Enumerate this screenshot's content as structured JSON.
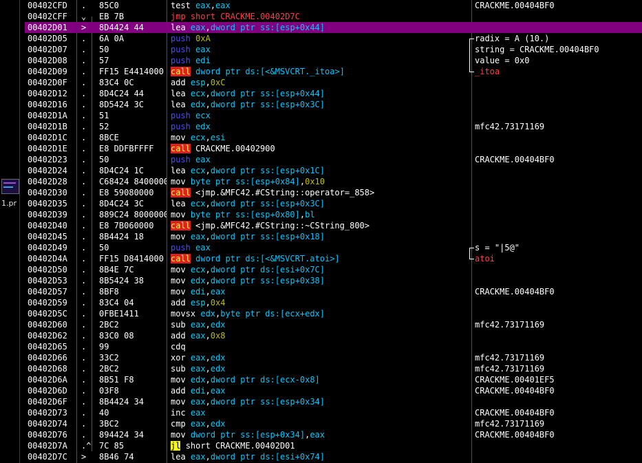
{
  "left_panel": {
    "thumbnail_label": "1.pr"
  },
  "rows": [
    {
      "addr": "00402CFD",
      "mark": ".",
      "hex": "85C0",
      "m": "test",
      "ops": [
        {
          "t": "eax",
          "k": "reg"
        },
        {
          "t": ",",
          "k": "sym"
        },
        {
          "t": "eax",
          "k": "reg"
        }
      ],
      "comment": "CRACKME.00404BF0"
    },
    {
      "addr": "00402CFF",
      "mark": "⌄",
      "hex": "EB 7B",
      "m": "jmp",
      "ops": [
        {
          "t": "short CRACKME.00402D7C",
          "k": "jmp"
        }
      ],
      "comment": ""
    },
    {
      "addr": "00402D01",
      "mark": ">",
      "hex": "8D4424 44",
      "m": "lea",
      "ops": [
        {
          "t": "eax",
          "k": "reg"
        },
        {
          "t": ",",
          "k": "sym"
        },
        {
          "t": "dword ptr ss:[esp+0x44]",
          "k": "mem"
        }
      ],
      "comment": "",
      "selected": true
    },
    {
      "addr": "00402D05",
      "mark": ".",
      "hex": "6A 0A",
      "m": "push",
      "ops": [
        {
          "t": "0xA",
          "k": "imm"
        }
      ],
      "comment": "radix = A (10.)",
      "bracket": "top"
    },
    {
      "addr": "00402D07",
      "mark": ".",
      "hex": "50",
      "m": "push",
      "ops": [
        {
          "t": "eax",
          "k": "reg"
        }
      ],
      "comment": "string = CRACKME.00404BF0",
      "bracket": "mid"
    },
    {
      "addr": "00402D08",
      "mark": ".",
      "hex": "57",
      "m": "push",
      "ops": [
        {
          "t": "edi",
          "k": "reg"
        }
      ],
      "comment": "value = 0x0",
      "bracket": "mid"
    },
    {
      "addr": "00402D09",
      "mark": ".",
      "hex": "FF15 E4414000",
      "m": "call",
      "ops": [
        {
          "t": "dword ptr ds:[<&MSVCRT._itoa>]",
          "k": "mem"
        }
      ],
      "comment": "_itoa",
      "bracket": "bot",
      "ccall": true
    },
    {
      "addr": "00402D0F",
      "mark": ".",
      "hex": "83C4 0C",
      "m": "add",
      "ops": [
        {
          "t": "esp",
          "k": "reg"
        },
        {
          "t": ",",
          "k": "sym"
        },
        {
          "t": "0xC",
          "k": "imm"
        }
      ],
      "comment": ""
    },
    {
      "addr": "00402D12",
      "mark": ".",
      "hex": "8D4C24 44",
      "m": "lea",
      "ops": [
        {
          "t": "ecx",
          "k": "reg"
        },
        {
          "t": ",",
          "k": "sym"
        },
        {
          "t": "dword ptr ss:[esp+0x44]",
          "k": "mem"
        }
      ],
      "comment": ""
    },
    {
      "addr": "00402D16",
      "mark": ".",
      "hex": "8D5424 3C",
      "m": "lea",
      "ops": [
        {
          "t": "edx",
          "k": "reg"
        },
        {
          "t": ",",
          "k": "sym"
        },
        {
          "t": "dword ptr ss:[esp+0x3C]",
          "k": "mem"
        }
      ],
      "comment": ""
    },
    {
      "addr": "00402D1A",
      "mark": ".",
      "hex": "51",
      "m": "push",
      "ops": [
        {
          "t": "ecx",
          "k": "reg"
        }
      ],
      "comment": ""
    },
    {
      "addr": "00402D1B",
      "mark": ".",
      "hex": "52",
      "m": "push",
      "ops": [
        {
          "t": "edx",
          "k": "reg"
        }
      ],
      "comment": "mfc42.73171169"
    },
    {
      "addr": "00402D1C",
      "mark": ".",
      "hex": "8BCE",
      "m": "mov",
      "ops": [
        {
          "t": "ecx",
          "k": "reg"
        },
        {
          "t": ",",
          "k": "sym"
        },
        {
          "t": "esi",
          "k": "reg"
        }
      ],
      "comment": ""
    },
    {
      "addr": "00402D1E",
      "mark": ".",
      "hex": "E8 DDFBFFFF",
      "m": "call",
      "ops": [
        {
          "t": "CRACKME.00402900",
          "k": "lbl"
        }
      ],
      "comment": ""
    },
    {
      "addr": "00402D23",
      "mark": ".",
      "hex": "50",
      "m": "push",
      "ops": [
        {
          "t": "eax",
          "k": "reg"
        }
      ],
      "comment": "CRACKME.00404BF0"
    },
    {
      "addr": "00402D24",
      "mark": ".",
      "hex": "8D4C24 1C",
      "m": "lea",
      "ops": [
        {
          "t": "ecx",
          "k": "reg"
        },
        {
          "t": ",",
          "k": "sym"
        },
        {
          "t": "dword ptr ss:[esp+0x1C]",
          "k": "mem"
        }
      ],
      "comment": ""
    },
    {
      "addr": "00402D28",
      "mark": ".",
      "hex": "C68424 84000000",
      "m": "mov",
      "ops": [
        {
          "t": "byte ptr ss:[esp+0x84]",
          "k": "mem"
        },
        {
          "t": ",",
          "k": "sym"
        },
        {
          "t": "0x10",
          "k": "imm"
        }
      ],
      "comment": ""
    },
    {
      "addr": "00402D30",
      "mark": ".",
      "hex": "E8 59080000",
      "m": "call",
      "ops": [
        {
          "t": "<jmp.&MFC42.#CString::operator=_858>",
          "k": "lbl"
        }
      ],
      "comment": ""
    },
    {
      "addr": "00402D35",
      "mark": ".",
      "hex": "8D4C24 3C",
      "m": "lea",
      "ops": [
        {
          "t": "ecx",
          "k": "reg"
        },
        {
          "t": ",",
          "k": "sym"
        },
        {
          "t": "dword ptr ss:[esp+0x3C]",
          "k": "mem"
        }
      ],
      "comment": ""
    },
    {
      "addr": "00402D39",
      "mark": ".",
      "hex": "889C24 80000000",
      "m": "mov",
      "ops": [
        {
          "t": "byte ptr ss:[esp+0x80]",
          "k": "mem"
        },
        {
          "t": ",",
          "k": "sym"
        },
        {
          "t": "bl",
          "k": "reg"
        }
      ],
      "comment": ""
    },
    {
      "addr": "00402D40",
      "mark": ".",
      "hex": "E8 7B060000",
      "m": "call",
      "ops": [
        {
          "t": "<jmp.&MFC42.#CString::~CString_800>",
          "k": "lbl"
        }
      ],
      "comment": ""
    },
    {
      "addr": "00402D45",
      "mark": ".",
      "hex": "8B4424 18",
      "m": "mov",
      "ops": [
        {
          "t": "eax",
          "k": "reg"
        },
        {
          "t": ",",
          "k": "sym"
        },
        {
          "t": "dword ptr ss:[esp+0x18]",
          "k": "mem"
        }
      ],
      "comment": ""
    },
    {
      "addr": "00402D49",
      "mark": ".",
      "hex": "50",
      "m": "push",
      "ops": [
        {
          "t": "eax",
          "k": "reg"
        }
      ],
      "comment": "s = \"|5@\"",
      "bracket": "top"
    },
    {
      "addr": "00402D4A",
      "mark": ".",
      "hex": "FF15 D8414000",
      "m": "call",
      "ops": [
        {
          "t": "dword ptr ds:[<&MSVCRT.atoi>]",
          "k": "mem"
        }
      ],
      "comment": "atoi",
      "bracket": "bot",
      "ccall": true
    },
    {
      "addr": "00402D50",
      "mark": ".",
      "hex": "8B4E 7C",
      "m": "mov",
      "ops": [
        {
          "t": "ecx",
          "k": "reg"
        },
        {
          "t": ",",
          "k": "sym"
        },
        {
          "t": "dword ptr ds:[esi+0x7C]",
          "k": "mem"
        }
      ],
      "comment": ""
    },
    {
      "addr": "00402D53",
      "mark": ".",
      "hex": "8B5424 38",
      "m": "mov",
      "ops": [
        {
          "t": "edx",
          "k": "reg"
        },
        {
          "t": ",",
          "k": "sym"
        },
        {
          "t": "dword ptr ss:[esp+0x38]",
          "k": "mem"
        }
      ],
      "comment": ""
    },
    {
      "addr": "00402D57",
      "mark": ".",
      "hex": "8BF8",
      "m": "mov",
      "ops": [
        {
          "t": "edi",
          "k": "reg"
        },
        {
          "t": ",",
          "k": "sym"
        },
        {
          "t": "eax",
          "k": "reg"
        }
      ],
      "comment": "CRACKME.00404BF0"
    },
    {
      "addr": "00402D59",
      "mark": ".",
      "hex": "83C4 04",
      "m": "add",
      "ops": [
        {
          "t": "esp",
          "k": "reg"
        },
        {
          "t": ",",
          "k": "sym"
        },
        {
          "t": "0x4",
          "k": "imm"
        }
      ],
      "comment": ""
    },
    {
      "addr": "00402D5C",
      "mark": ".",
      "hex": "0FBE1411",
      "m": "movsx",
      "ops": [
        {
          "t": "edx",
          "k": "reg"
        },
        {
          "t": ",",
          "k": "sym"
        },
        {
          "t": "byte ptr ds:[ecx+edx]",
          "k": "mem"
        }
      ],
      "comment": ""
    },
    {
      "addr": "00402D60",
      "mark": ".",
      "hex": "2BC2",
      "m": "sub",
      "ops": [
        {
          "t": "eax",
          "k": "reg"
        },
        {
          "t": ",",
          "k": "sym"
        },
        {
          "t": "edx",
          "k": "reg"
        }
      ],
      "comment": "mfc42.73171169"
    },
    {
      "addr": "00402D62",
      "mark": ".",
      "hex": "83C0 08",
      "m": "add",
      "ops": [
        {
          "t": "eax",
          "k": "reg"
        },
        {
          "t": ",",
          "k": "sym"
        },
        {
          "t": "0x8",
          "k": "imm"
        }
      ],
      "comment": ""
    },
    {
      "addr": "00402D65",
      "mark": ".",
      "hex": "99",
      "m": "cdq",
      "ops": [],
      "comment": ""
    },
    {
      "addr": "00402D66",
      "mark": ".",
      "hex": "33C2",
      "m": "xor",
      "ops": [
        {
          "t": "eax",
          "k": "reg"
        },
        {
          "t": ",",
          "k": "sym"
        },
        {
          "t": "edx",
          "k": "reg"
        }
      ],
      "comment": "mfc42.73171169"
    },
    {
      "addr": "00402D68",
      "mark": ".",
      "hex": "2BC2",
      "m": "sub",
      "ops": [
        {
          "t": "eax",
          "k": "reg"
        },
        {
          "t": ",",
          "k": "sym"
        },
        {
          "t": "edx",
          "k": "reg"
        }
      ],
      "comment": "mfc42.73171169"
    },
    {
      "addr": "00402D6A",
      "mark": ".",
      "hex": "8B51 F8",
      "m": "mov",
      "ops": [
        {
          "t": "edx",
          "k": "reg"
        },
        {
          "t": ",",
          "k": "sym"
        },
        {
          "t": "dword ptr ds:[ecx-0x8]",
          "k": "mem"
        }
      ],
      "comment": "CRACKME.00401EF5"
    },
    {
      "addr": "00402D6D",
      "mark": ".",
      "hex": "03F8",
      "m": "add",
      "ops": [
        {
          "t": "edi",
          "k": "reg"
        },
        {
          "t": ",",
          "k": "sym"
        },
        {
          "t": "eax",
          "k": "reg"
        }
      ],
      "comment": "CRACKME.00404BF0"
    },
    {
      "addr": "00402D6F",
      "mark": ".",
      "hex": "8B4424 34",
      "m": "mov",
      "ops": [
        {
          "t": "eax",
          "k": "reg"
        },
        {
          "t": ",",
          "k": "sym"
        },
        {
          "t": "dword ptr ss:[esp+0x34]",
          "k": "mem"
        }
      ],
      "comment": ""
    },
    {
      "addr": "00402D73",
      "mark": ".",
      "hex": "40",
      "m": "inc",
      "ops": [
        {
          "t": "eax",
          "k": "reg"
        }
      ],
      "comment": "CRACKME.00404BF0"
    },
    {
      "addr": "00402D74",
      "mark": ".",
      "hex": "3BC2",
      "m": "cmp",
      "ops": [
        {
          "t": "eax",
          "k": "reg"
        },
        {
          "t": ",",
          "k": "sym"
        },
        {
          "t": "edx",
          "k": "reg"
        }
      ],
      "comment": "mfc42.73171169"
    },
    {
      "addr": "00402D76",
      "mark": ".",
      "hex": "894424 34",
      "m": "mov",
      "ops": [
        {
          "t": "dword ptr ss:[esp+0x34]",
          "k": "mem"
        },
        {
          "t": ",",
          "k": "sym"
        },
        {
          "t": "eax",
          "k": "reg"
        }
      ],
      "comment": "CRACKME.00404BF0"
    },
    {
      "addr": "00402D7A",
      "mark": ".^",
      "hex": "7C 85",
      "m": "jl",
      "ops": [
        {
          "t": "short CRACKME.00402D01",
          "k": "lbl"
        }
      ],
      "comment": ""
    },
    {
      "addr": "00402D7C",
      "mark": ">",
      "hex": "8B46 74",
      "m": "lea",
      "ops": [
        {
          "t": "eax",
          "k": "reg"
        },
        {
          "t": ",",
          "k": "sym"
        },
        {
          "t": "dword ptr ds:[esi+0x74]",
          "k": "mem"
        }
      ],
      "comment": ""
    }
  ]
}
